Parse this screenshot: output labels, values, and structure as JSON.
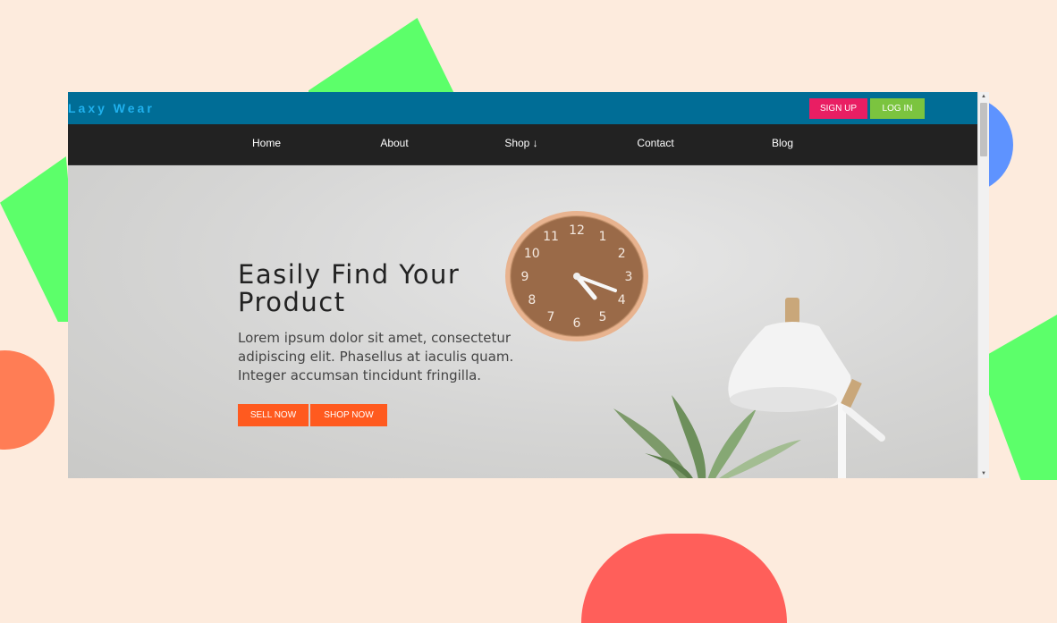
{
  "brand": {
    "name": "Laxy Wear"
  },
  "auth": {
    "signup_label": "SIGN UP",
    "login_label": "LOG IN"
  },
  "nav": {
    "items": [
      {
        "label": "Home"
      },
      {
        "label": "About"
      },
      {
        "label": "Shop ↓"
      },
      {
        "label": "Contact"
      },
      {
        "label": "Blog"
      }
    ]
  },
  "hero": {
    "title": "Easily Find Your Product",
    "text": "Lorem ipsum dolor sit amet, consectetur adipiscing elit. Phasellus at iaculis quam. Integer accumsan tincidunt fringilla.",
    "sell_label": "SELL NOW",
    "shop_label": "SHOP NOW",
    "clock_numbers": [
      "12",
      "1",
      "2",
      "3",
      "4",
      "5",
      "6",
      "7",
      "8",
      "9",
      "10",
      "11"
    ]
  },
  "colors": {
    "background": "#fdebdd",
    "topbar": "#006d96",
    "navbar": "#222222",
    "brand_text": "#1fb1ee",
    "signup": "#e91e63",
    "login": "#7bc43f",
    "cta": "#ff5a1f"
  }
}
